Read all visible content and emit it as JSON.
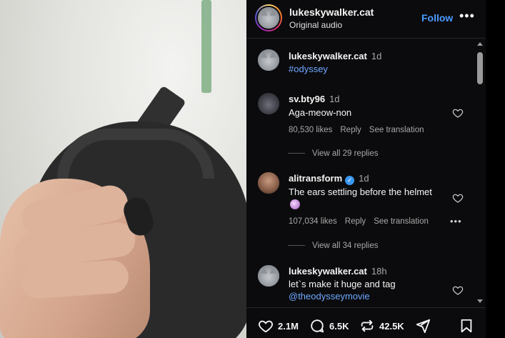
{
  "header": {
    "username": "lukeskywalker.cat",
    "subtitle": "Original audio",
    "follow_label": "Follow",
    "more_label": "•••"
  },
  "caption": {
    "username": "lukeskywalker.cat",
    "time": "1d",
    "hashtag": "#odyssey"
  },
  "comments": [
    {
      "username": "sv.bty96",
      "time": "1d",
      "text": "Aga-meow-non",
      "likes": "80,530 likes",
      "reply_label": "Reply",
      "translate_label": "See translation",
      "view_replies": "View all 29 replies"
    },
    {
      "username": "alitransform",
      "verified": true,
      "time": "1d",
      "text": "The ears settling before the helmet",
      "likes": "107,034 likes",
      "reply_label": "Reply",
      "translate_label": "See translation",
      "more_label": "•••",
      "view_replies": "View all 34 replies"
    },
    {
      "username": "lukeskywalker.cat",
      "time": "18h",
      "text": "let`s make it huge and tag",
      "mention": "@theodysseymovie"
    }
  ],
  "actions": {
    "likes": "2.1M",
    "comments": "6.5K",
    "reposts": "42.5K"
  },
  "colors": {
    "accent": "#4a9bff",
    "link": "#6ea8fe",
    "panel_bg": "#0b0b0d",
    "muted_text": "#a8a8a8"
  },
  "icons": [
    "heart-icon",
    "comment-icon",
    "repost-icon",
    "share-icon",
    "bookmark-icon",
    "verified-icon",
    "more-icon"
  ]
}
